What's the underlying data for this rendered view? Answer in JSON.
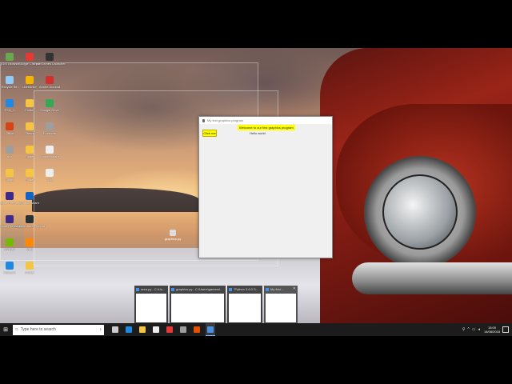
{
  "desktop": {
    "icons": [
      {
        "label": "QGIS Browser",
        "color": "#6aa84f"
      },
      {
        "label": "Google Chrome",
        "color": "#e53935"
      },
      {
        "label": "Epic Games Launcher",
        "color": "#333333"
      },
      {
        "label": "Recycle Bin",
        "color": "#90caf9"
      },
      {
        "label": "uberstrike",
        "color": "#f4b400"
      },
      {
        "label": "Adobe Acrobat",
        "color": "#d32f2f"
      },
      {
        "label": "ESQ_1",
        "color": "#1e88e5"
      },
      {
        "label": "Folder",
        "color": "#f4c542"
      },
      {
        "label": "Google Drive",
        "color": "#34a853"
      },
      {
        "label": "Office",
        "color": "#d84315"
      },
      {
        "label": "Steam",
        "color": "#f4c542"
      },
      {
        "label": "Evernote",
        "color": "#9e9e9e"
      },
      {
        "label": "Nox",
        "color": "#9e9e9e"
      },
      {
        "label": "Folder",
        "color": "#f4c542"
      },
      {
        "label": "Wondershare",
        "color": "#eeeeee"
      },
      {
        "label": "Folder",
        "color": "#f4c542"
      },
      {
        "label": "Folder",
        "color": "#f4c542"
      },
      {
        "label": "Doc",
        "color": "#eeeeee"
      },
      {
        "label": "Adobe Premiere",
        "color": "#3d2a8a"
      },
      {
        "label": "Wondershare",
        "color": "#1565c0"
      },
      {
        "label": "Wondershare Filmora",
        "color": "#263238"
      },
      {
        "label": "Adobe Premiere",
        "color": "#3d2a8a"
      },
      {
        "label": "Wondershare Filmora",
        "color": "#263238"
      },
      {
        "label": "Folder",
        "color": "#f4c542"
      },
      {
        "label": "NVIDIA",
        "color": "#76b900"
      },
      {
        "label": "VLC",
        "color": "#ff8800"
      },
      {
        "label": "Folder",
        "color": "#f4c542"
      },
      {
        "label": "Network",
        "color": "#1e88e5"
      },
      {
        "label": "Folder",
        "color": "#f4c542"
      },
      {
        "label": "Folder",
        "color": "#f4c542"
      }
    ],
    "desk_file_label": "graphics.py"
  },
  "app_window": {
    "title": "My first graphics program",
    "welcome_text": "Welcome to our first graphics program",
    "hello_text": "Hello world",
    "button_label": "Click me"
  },
  "taskbar_previews": [
    {
      "title": "area.py - C:\\Us..."
    },
    {
      "title": "graphics.py - C:\\Users\\gamers\\..."
    },
    {
      "title": "\"Python 3.6.0 S..."
    },
    {
      "title": "My first ..."
    }
  ],
  "taskbar": {
    "search_placeholder": "Type here to search",
    "time": "15:00",
    "date": "14/08/2018",
    "pinned": [
      {
        "name": "task-view",
        "color": "#cccccc"
      },
      {
        "name": "edge",
        "color": "#1e88e5"
      },
      {
        "name": "file-explorer",
        "color": "#f4c542"
      },
      {
        "name": "store",
        "color": "#eeeeee"
      },
      {
        "name": "chrome",
        "color": "#e53935"
      },
      {
        "name": "app",
        "color": "#9e9e9e"
      },
      {
        "name": "app2",
        "color": "#e65100"
      },
      {
        "name": "python",
        "color": "#4a90e2"
      }
    ]
  }
}
